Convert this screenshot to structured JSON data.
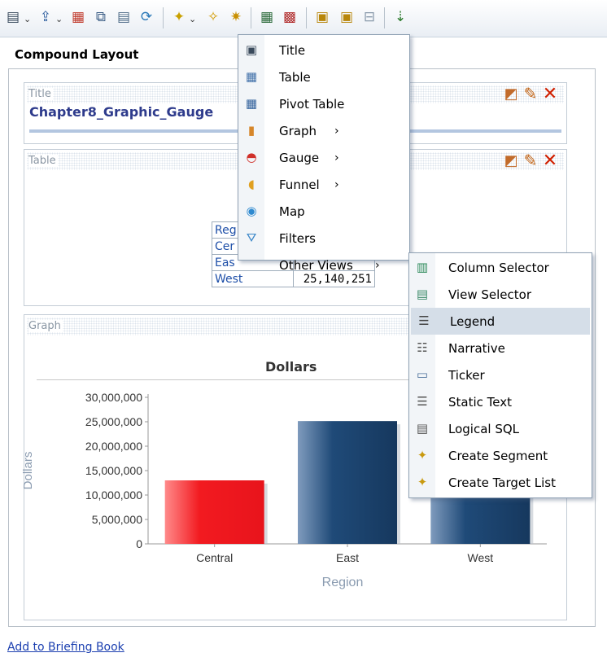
{
  "toolbar": {
    "icons": [
      {
        "name": "print-icon",
        "glyph": "🖶"
      },
      {
        "name": "export-icon",
        "glyph": "⇪"
      },
      {
        "name": "schedule-icon",
        "glyph": "▦"
      },
      {
        "name": "preview-icon",
        "glyph": "⧉"
      },
      {
        "name": "save-view-icon",
        "glyph": "▤"
      },
      {
        "name": "refresh-icon",
        "glyph": "⟳"
      },
      {
        "name": "new-view-icon",
        "glyph": "✦"
      },
      {
        "name": "duplicate-view-icon",
        "glyph": "✧"
      },
      {
        "name": "remove-view-icon",
        "glyph": "✷"
      },
      {
        "name": "edit-analysis-icon",
        "glyph": "▦"
      },
      {
        "name": "edit-data-icon",
        "glyph": "▩"
      },
      {
        "name": "compound-layout-icon",
        "glyph": "▣"
      },
      {
        "name": "create-layout-icon",
        "glyph": "▣"
      },
      {
        "name": "delete-layout-icon",
        "glyph": "⊟"
      },
      {
        "name": "sort-icon",
        "glyph": "⇣"
      }
    ]
  },
  "section_title": "Compound Layout",
  "views": {
    "title": {
      "label": "Title",
      "text": "Chapter8_Graphic_Gauge"
    },
    "table": {
      "label": "Table",
      "rows": [
        {
          "region": "Reg",
          "value": ""
        },
        {
          "region": "Cer",
          "value": ""
        },
        {
          "region": "Eas",
          "value": ""
        },
        {
          "region": "West",
          "value": "25,140,251"
        }
      ]
    },
    "graph": {
      "label": "Graph"
    }
  },
  "chart_data": {
    "type": "bar",
    "title": "Dollars",
    "xlabel": "Region",
    "ylabel": "Dollars",
    "categories": [
      "Central",
      "East",
      "West"
    ],
    "values": [
      13000000,
      25140251,
      20000000
    ],
    "ylim": [
      0,
      30000000
    ],
    "yticks": [
      "0",
      "5,000,000",
      "10,000,000",
      "15,000,000",
      "20,000,000",
      "25,000,000",
      "30,000,000"
    ],
    "colors": {
      "Central": "#e8141c",
      "East": "#1f4a78",
      "West": "#1f4a78"
    },
    "grid": false
  },
  "new_view_menu": {
    "items": [
      {
        "label": "Title",
        "icon": "title-icon",
        "arrow": ""
      },
      {
        "label": "Table",
        "icon": "table-icon",
        "arrow": ""
      },
      {
        "label": "Pivot Table",
        "icon": "pivot-table-icon",
        "arrow": ""
      },
      {
        "label": "Graph",
        "icon": "graph-icon",
        "arrow": "›"
      },
      {
        "label": "Gauge",
        "icon": "gauge-icon",
        "arrow": "›"
      },
      {
        "label": "Funnel",
        "icon": "funnel-icon",
        "arrow": "›"
      },
      {
        "label": "Map",
        "icon": "map-icon",
        "arrow": ""
      },
      {
        "label": "Filters",
        "icon": "filters-icon",
        "arrow": ""
      },
      {
        "label": "Other Views",
        "icon": "",
        "arrow": "›"
      }
    ]
  },
  "other_views_menu": {
    "items": [
      {
        "label": "Column Selector",
        "icon": "column-selector-icon"
      },
      {
        "label": "View Selector",
        "icon": "view-selector-icon"
      },
      {
        "label": "Legend",
        "icon": "legend-icon"
      },
      {
        "label": "Narrative",
        "icon": "narrative-icon"
      },
      {
        "label": "Ticker",
        "icon": "ticker-icon"
      },
      {
        "label": "Static Text",
        "icon": "static-text-icon"
      },
      {
        "label": "Logical SQL",
        "icon": "logical-sql-icon"
      },
      {
        "label": "Create Segment",
        "icon": "create-segment-icon"
      },
      {
        "label": "Create Target List",
        "icon": "create-target-list-icon"
      }
    ],
    "highlighted": "Legend"
  },
  "footer": {
    "link": "Add to Briefing Book"
  }
}
